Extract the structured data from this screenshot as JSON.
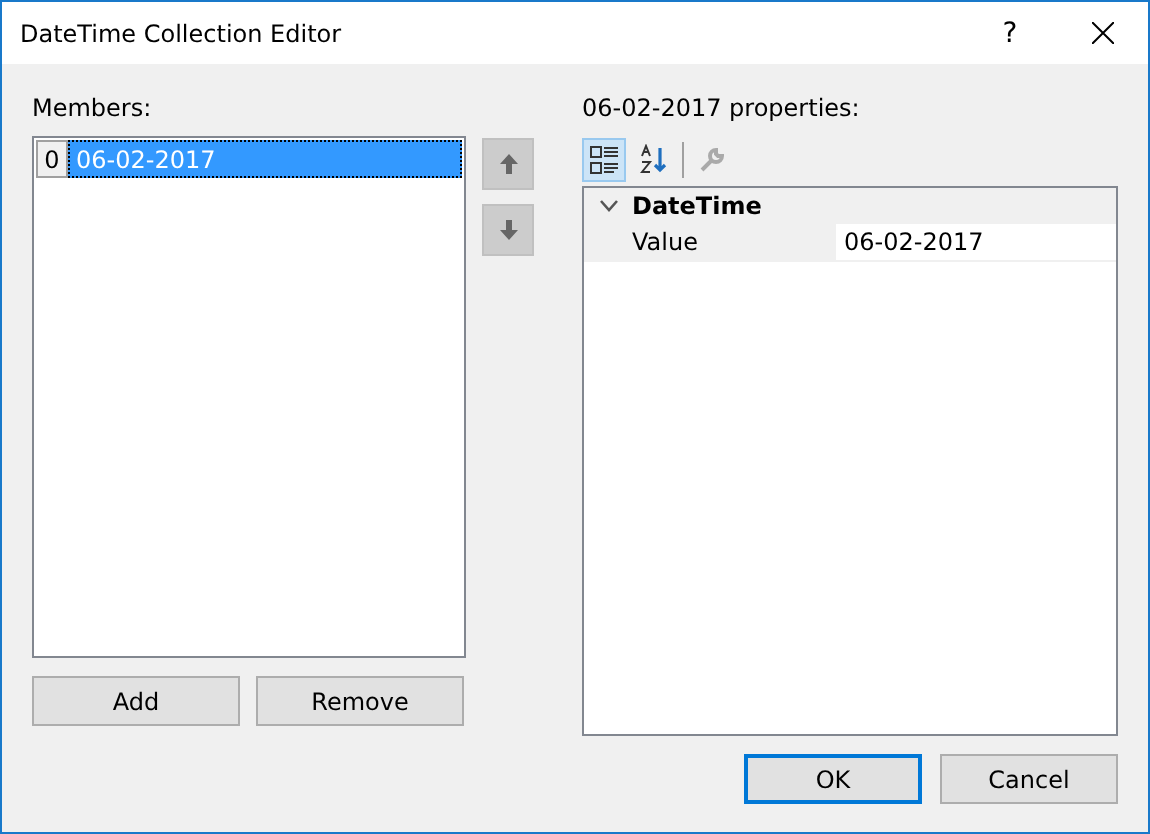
{
  "window": {
    "title": "DateTime Collection Editor",
    "help": "?"
  },
  "members": {
    "label": "Members:",
    "items": [
      {
        "index": "0",
        "value": "06-02-2017",
        "selected": true
      }
    ],
    "buttons": [
      "Add",
      "Remove"
    ]
  },
  "properties": {
    "label": "06-02-2017 properties:",
    "toolbar": [
      {
        "kind": "categorized",
        "selected": true,
        "disabled": false
      },
      {
        "kind": "alphabetical",
        "selected": false,
        "disabled": false
      },
      {
        "kind": "pages",
        "selected": false,
        "disabled": true
      }
    ],
    "categories": [
      {
        "name": "DateTime",
        "expanded": true,
        "rows": [
          {
            "name": "Value",
            "value": "06-02-2017"
          }
        ]
      }
    ]
  },
  "buttons": [
    {
      "label": "OK",
      "default": true
    },
    {
      "label": "Cancel",
      "default": false
    }
  ]
}
